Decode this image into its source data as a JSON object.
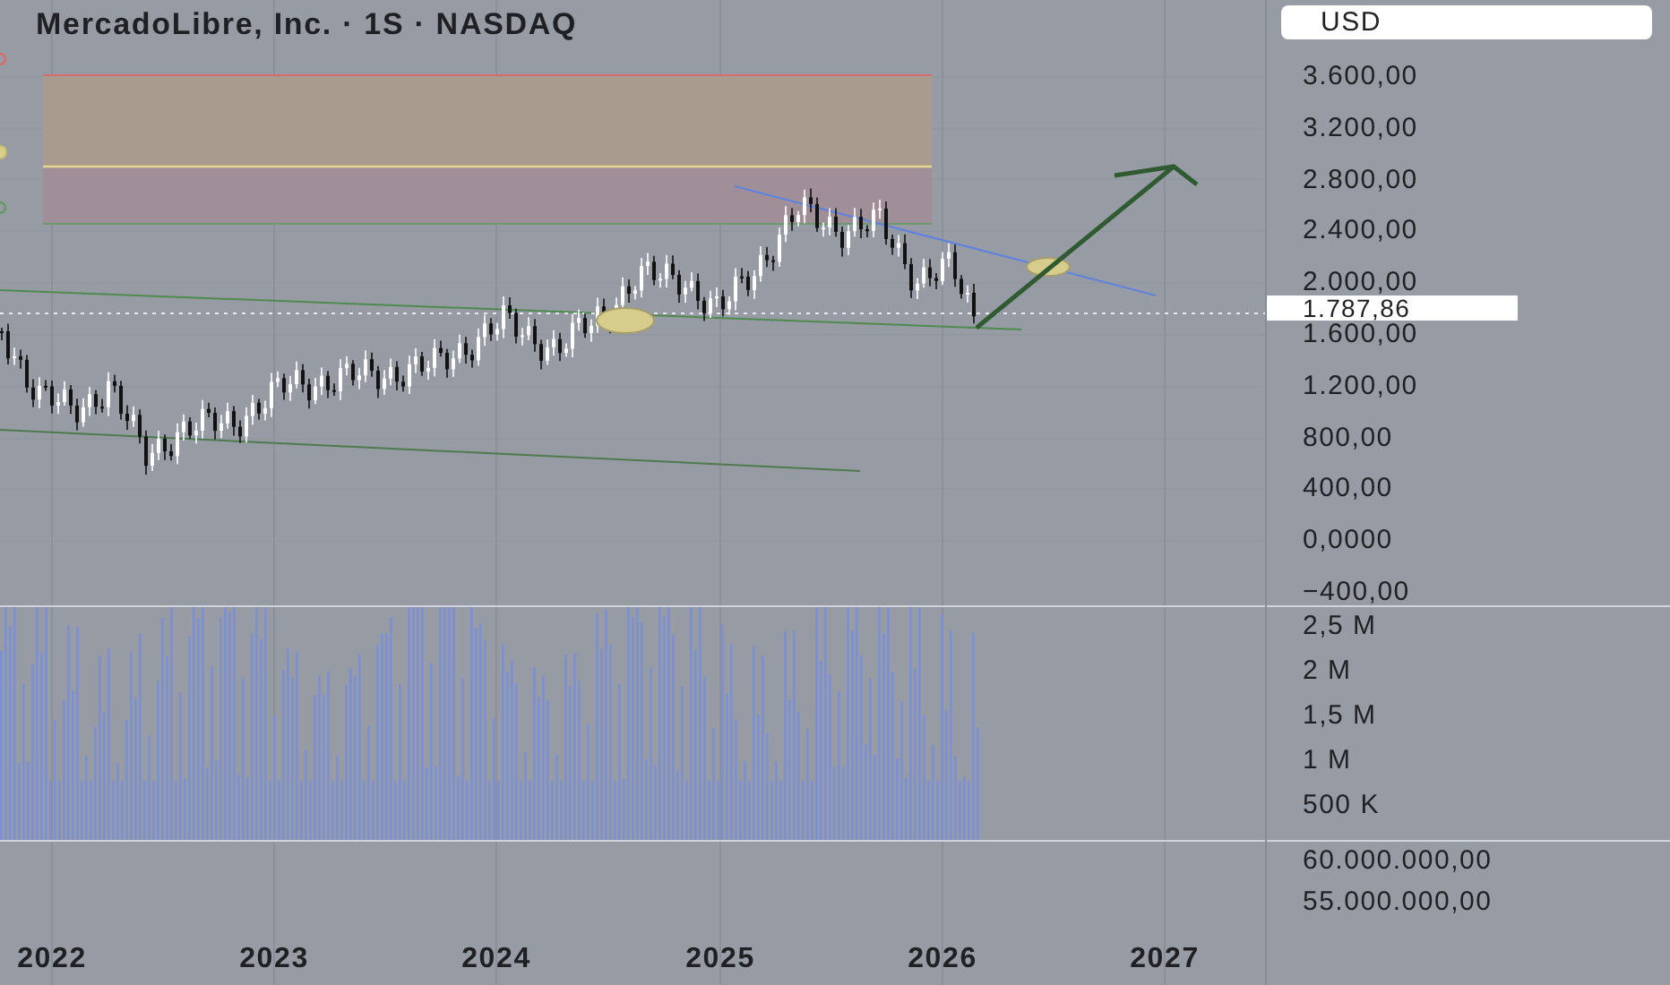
{
  "title": "MercadoLibre, Inc. · 1S · NASDAQ",
  "price_axis": {
    "currency": "USD",
    "labels": [
      "3.600,00",
      "3.200,00",
      "2.800,00",
      "2.400,00",
      "2.000,00",
      "1.600,00",
      "1.200,00",
      "800,00",
      "400,00",
      "0,0000",
      "−400,00"
    ],
    "last_price": "1.787,86"
  },
  "volume_axis": {
    "labels": [
      "2,5 M",
      "2 M",
      "1,5 M",
      "1 M",
      "500 K"
    ]
  },
  "lower_axis": {
    "labels": [
      "60.000.000,00",
      "55.000.000,00"
    ]
  },
  "time_axis": {
    "labels": [
      "2022",
      "2023",
      "2024",
      "2025",
      "2026",
      "2027"
    ]
  }
}
